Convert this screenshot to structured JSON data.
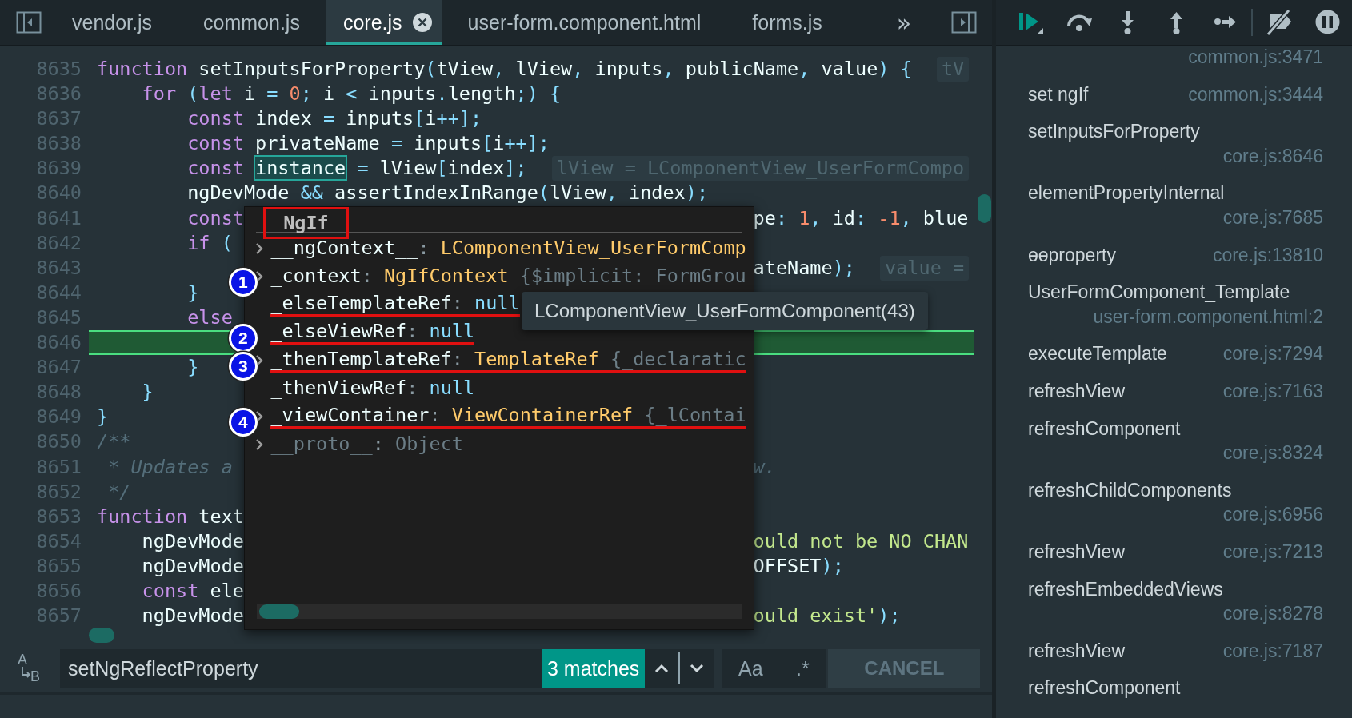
{
  "tabs": [
    {
      "label": "vendor.js",
      "selected": false,
      "closable": false
    },
    {
      "label": "common.js",
      "selected": false,
      "closable": false
    },
    {
      "label": "core.js",
      "selected": true,
      "closable": true
    },
    {
      "label": "user-form.component.html",
      "selected": false,
      "closable": false
    },
    {
      "label": "forms.js",
      "selected": false,
      "closable": false
    }
  ],
  "more_tabs": "»",
  "code": {
    "lines": [
      {
        "number": "8635",
        "highlighted": false,
        "code": [
          {
            "kind": "kw",
            "text": "function"
          },
          {
            "kind": "id",
            "text": " setInputsForProperty"
          },
          {
            "kind": "p",
            "text": "("
          },
          {
            "kind": "id",
            "text": "tView"
          },
          {
            "kind": "p",
            "text": ","
          },
          {
            "kind": "id",
            "text": " lView"
          },
          {
            "kind": "p",
            "text": ","
          },
          {
            "kind": "id",
            "text": " inputs"
          },
          {
            "kind": "p",
            "text": ","
          },
          {
            "kind": "id",
            "text": " publicName"
          },
          {
            "kind": "p",
            "text": ","
          },
          {
            "kind": "id",
            "text": " value"
          },
          {
            "kind": "p",
            "text": ") {"
          }
        ],
        "hint": "tV"
      },
      {
        "number": "8636",
        "highlighted": false,
        "code": [
          {
            "kind": "kw",
            "text": "    for"
          },
          {
            "kind": "p",
            "text": " ("
          },
          {
            "kind": "kw",
            "text": "let"
          },
          {
            "kind": "id",
            "text": " i "
          },
          {
            "kind": "p",
            "text": "="
          },
          {
            "kind": "num",
            "text": " 0"
          },
          {
            "kind": "p",
            "text": ";"
          },
          {
            "kind": "id",
            "text": " i "
          },
          {
            "kind": "p",
            "text": "<"
          },
          {
            "kind": "id",
            "text": " inputs"
          },
          {
            "kind": "p",
            "text": "."
          },
          {
            "kind": "id",
            "text": "length"
          },
          {
            "kind": "p",
            "text": ";) {"
          }
        ]
      },
      {
        "number": "8637",
        "highlighted": false,
        "code": [
          {
            "kind": "kw",
            "text": "        const"
          },
          {
            "kind": "id",
            "text": " index "
          },
          {
            "kind": "p",
            "text": "="
          },
          {
            "kind": "id",
            "text": " inputs"
          },
          {
            "kind": "p",
            "text": "["
          },
          {
            "kind": "id",
            "text": "i"
          },
          {
            "kind": "p",
            "text": "++];"
          }
        ]
      },
      {
        "number": "8638",
        "highlighted": false,
        "code": [
          {
            "kind": "kw",
            "text": "        const"
          },
          {
            "kind": "id",
            "text": " privateName "
          },
          {
            "kind": "p",
            "text": "="
          },
          {
            "kind": "id",
            "text": " inputs"
          },
          {
            "kind": "p",
            "text": "["
          },
          {
            "kind": "id",
            "text": "i"
          },
          {
            "kind": "p",
            "text": "++];"
          }
        ]
      },
      {
        "number": "8639",
        "highlighted": false,
        "code": [
          {
            "kind": "kw",
            "text": "        const "
          },
          {
            "kind": "sel",
            "text": "instance"
          },
          {
            "kind": "p",
            "text": " ="
          },
          {
            "kind": "id",
            "text": " lView"
          },
          {
            "kind": "p",
            "text": "["
          },
          {
            "kind": "id",
            "text": "index"
          },
          {
            "kind": "p",
            "text": "];"
          }
        ],
        "hint": "lView = LComponentView_UserFormCompo"
      },
      {
        "number": "8640",
        "highlighted": false,
        "code": [
          {
            "kind": "id",
            "text": "        ngDevMode "
          },
          {
            "kind": "p",
            "text": "&&"
          },
          {
            "kind": "id",
            "text": " assertIndexInRange"
          },
          {
            "kind": "p",
            "text": "("
          },
          {
            "kind": "id",
            "text": "lView"
          },
          {
            "kind": "p",
            "text": ","
          },
          {
            "kind": "id",
            "text": " index"
          },
          {
            "kind": "p",
            "text": ");"
          }
        ]
      },
      {
        "number": "8641",
        "highlighted": false,
        "code": [
          {
            "kind": "kw",
            "text": "        const"
          }
        ],
        "tail": [
          {
            "kind": "id",
            "text": "pe"
          },
          {
            "kind": "p",
            "text": ":"
          },
          {
            "kind": "num",
            "text": " 1"
          },
          {
            "kind": "p",
            "text": ","
          },
          {
            "kind": "id",
            "text": " id"
          },
          {
            "kind": "p",
            "text": ":"
          },
          {
            "kind": "num",
            "text": " -1"
          },
          {
            "kind": "p",
            "text": ","
          },
          {
            "kind": "id",
            "text": " blue"
          }
        ]
      },
      {
        "number": "8642",
        "highlighted": false,
        "code": [
          {
            "kind": "kw",
            "text": "        if"
          },
          {
            "kind": "p",
            "text": " ("
          }
        ]
      },
      {
        "number": "8643",
        "highlighted": false,
        "tail": [
          {
            "kind": "id",
            "text": "ateName"
          },
          {
            "kind": "p",
            "text": ");"
          }
        ],
        "tail_hint": "value ="
      },
      {
        "number": "8644",
        "highlighted": false,
        "code": [
          {
            "kind": "p",
            "text": "        }"
          }
        ]
      },
      {
        "number": "8645",
        "highlighted": false,
        "code": [
          {
            "kind": "kw",
            "text": "        else"
          }
        ]
      },
      {
        "number": "8646",
        "highlighted": true
      },
      {
        "number": "8647",
        "highlighted": false,
        "code": [
          {
            "kind": "p",
            "text": "        }"
          }
        ]
      },
      {
        "number": "8648",
        "highlighted": false,
        "code": [
          {
            "kind": "p",
            "text": "    }"
          }
        ]
      },
      {
        "number": "8649",
        "highlighted": false,
        "code": [
          {
            "kind": "p",
            "text": "}"
          }
        ]
      },
      {
        "number": "8650",
        "highlighted": false,
        "code": [
          {
            "kind": "cm",
            "text": "/**"
          }
        ]
      },
      {
        "number": "8651",
        "highlighted": false,
        "code": [
          {
            "kind": "cm",
            "text": " * Updates a"
          }
        ],
        "tail": [
          {
            "kind": "cm",
            "text": "w."
          }
        ]
      },
      {
        "number": "8652",
        "highlighted": false,
        "code": [
          {
            "kind": "cm",
            "text": " */"
          }
        ]
      },
      {
        "number": "8653",
        "highlighted": false,
        "code": [
          {
            "kind": "kw",
            "text": "function"
          },
          {
            "kind": "id",
            "text": " text"
          }
        ]
      },
      {
        "number": "8654",
        "highlighted": false,
        "code": [
          {
            "kind": "id",
            "text": "    ngDevMode"
          }
        ],
        "tail": [
          {
            "kind": "str",
            "text": "ould not be NO_CHAN"
          }
        ]
      },
      {
        "number": "8655",
        "highlighted": false,
        "code": [
          {
            "kind": "id",
            "text": "    ngDevMode"
          }
        ],
        "tail": [
          {
            "kind": "id",
            "text": "OFFSET"
          },
          {
            "kind": "p",
            "text": ");"
          }
        ]
      },
      {
        "number": "8656",
        "highlighted": false,
        "code": [
          {
            "kind": "kw",
            "text": "    const"
          },
          {
            "kind": "id",
            "text": " ele"
          }
        ]
      },
      {
        "number": "8657",
        "highlighted": false,
        "code": [
          {
            "kind": "id",
            "text": "    ngDevMode"
          }
        ],
        "tail": [
          {
            "kind": "str",
            "text": "ould exist'"
          },
          {
            "kind": "p",
            "text": ");"
          }
        ]
      }
    ]
  },
  "popup": {
    "header": {
      "text": "NgIf",
      "boxed": true
    },
    "rows": [
      {
        "expandable": true,
        "underlined": false,
        "text": [
          {
            "kind": "key",
            "text": "__ngContext__"
          },
          {
            "kind": "colon",
            "text": ": "
          },
          {
            "kind": "cls",
            "text": "LComponentView_UserFormComp"
          }
        ]
      },
      {
        "expandable": true,
        "underlined": false,
        "marker": "1",
        "text": [
          {
            "kind": "key",
            "text": "_context"
          },
          {
            "kind": "colon",
            "text": ": "
          },
          {
            "kind": "cls",
            "text": "NgIfContext"
          },
          {
            "kind": "brace",
            "text": " {$implicit: FormGrou"
          }
        ]
      },
      {
        "expandable": false,
        "underlined": true,
        "text": [
          {
            "kind": "key",
            "text": "_elseTemplateRef"
          },
          {
            "kind": "colon",
            "text": ": "
          },
          {
            "kind": "null",
            "text": "null"
          }
        ]
      },
      {
        "expandable": false,
        "underlined": true,
        "marker": "2",
        "text": [
          {
            "kind": "key",
            "text": "_elseViewRef"
          },
          {
            "kind": "colon",
            "text": ": "
          },
          {
            "kind": "null",
            "text": "null"
          }
        ]
      },
      {
        "expandable": true,
        "underlined": true,
        "marker": "3",
        "text": [
          {
            "kind": "key",
            "text": "_thenTemplateRef"
          },
          {
            "kind": "colon",
            "text": ": "
          },
          {
            "kind": "cls",
            "text": "TemplateRef"
          },
          {
            "kind": "brace",
            "text": " {_declaratic"
          }
        ]
      },
      {
        "expandable": false,
        "underlined": false,
        "text": [
          {
            "kind": "key",
            "text": "_thenViewRef"
          },
          {
            "kind": "colon",
            "text": ": "
          },
          {
            "kind": "null",
            "text": "null"
          }
        ]
      },
      {
        "expandable": true,
        "underlined": true,
        "marker": "4",
        "text": [
          {
            "kind": "key",
            "text": "_viewContainer"
          },
          {
            "kind": "colon",
            "text": ": "
          },
          {
            "kind": "cls",
            "text": "ViewContainerRef"
          },
          {
            "kind": "brace",
            "text": " {_lContai"
          }
        ]
      },
      {
        "expandable": true,
        "underlined": false,
        "text": [
          {
            "kind": "dimkey",
            "text": "__proto__"
          },
          {
            "kind": "colon",
            "text": ": "
          },
          {
            "kind": "brace",
            "text": "Object"
          }
        ]
      }
    ]
  },
  "tooltip": "LComponentView_UserFormComponent(43)",
  "search": {
    "replace_toggle": [
      "A",
      "B"
    ],
    "value": "setNgReflectProperty",
    "matches": "3 matches",
    "case_toggle": "Aa",
    "regex_toggle": ".*",
    "cancel": {
      "label": "CANCEL",
      "disabled": true
    }
  },
  "call_stack": [
    {
      "location": "common.js:3471"
    },
    {
      "name": "set ngIf",
      "location": "common.js:3444"
    },
    {
      "name": "setInputsForProperty",
      "location": "core.js:8646"
    },
    {
      "name": "elementPropertyInternal",
      "location": "core.js:7685"
    },
    {
      "name": "ɵɵproperty",
      "location": "core.js:13810"
    },
    {
      "name": "UserFormComponent_Template",
      "location": "user-form.component.html:2"
    },
    {
      "name": "executeTemplate",
      "location": "core.js:7294"
    },
    {
      "name": "refreshView",
      "location": "core.js:7163"
    },
    {
      "name": "refreshComponent",
      "location": "core.js:8324"
    },
    {
      "name": "refreshChildComponents",
      "location": "core.js:6956"
    },
    {
      "name": "refreshView",
      "location": "core.js:7213"
    },
    {
      "name": "refreshEmbeddedViews",
      "location": "core.js:8278"
    },
    {
      "name": "refreshView",
      "location": "core.js:7187"
    },
    {
      "name": "refreshComponent"
    }
  ]
}
